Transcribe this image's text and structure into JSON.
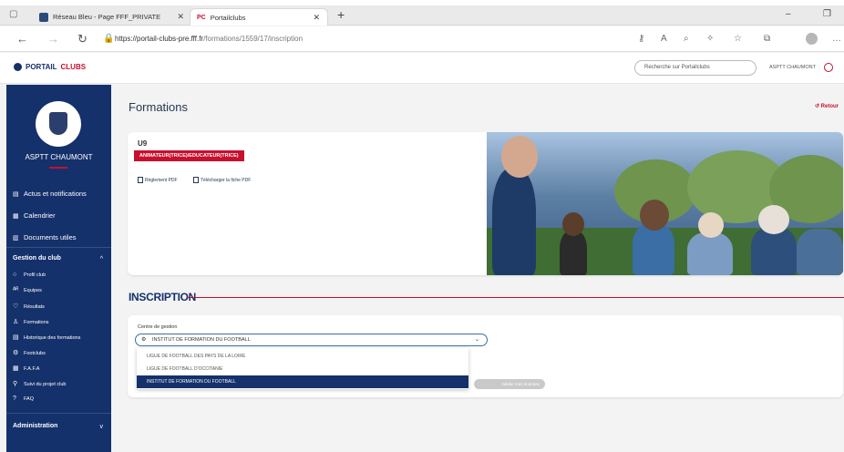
{
  "browser": {
    "tabs": [
      {
        "title": "Réseau Bleu - Page FFF_PRIVATE",
        "active": false
      },
      {
        "title": "Portailclubs",
        "favicon_text": "PC",
        "active": true
      }
    ],
    "url_base": "https://portail-clubs-pre.fff.fr",
    "url_path": "/formations/1559/17/inscription"
  },
  "header": {
    "logo_part1": "PORTAIL",
    "logo_part2": "CLUBS",
    "search_placeholder": "Recherche sur Portailclubs",
    "user": "ASPTT CHAUMONT"
  },
  "sidebar": {
    "club_name": "ASPTT CHAUMONT",
    "items": [
      {
        "label": "Actus et notifications",
        "icon": "news-icon"
      },
      {
        "label": "Calendrier",
        "icon": "calendar-icon"
      },
      {
        "label": "Documents utiles",
        "icon": "documents-icon"
      }
    ],
    "section_gestion": "Gestion du club",
    "sub_items": [
      {
        "label": "Profil club",
        "icon": "profile-icon"
      },
      {
        "label": "Equipes",
        "icon": "teams-icon"
      },
      {
        "label": "Résultats",
        "icon": "trophy-icon"
      },
      {
        "label": "Formations",
        "icon": "person-icon"
      },
      {
        "label": "Historique des formations",
        "icon": "history-icon"
      },
      {
        "label": "Footclubs",
        "icon": "football-icon"
      },
      {
        "label": "F.A.F.A",
        "icon": "grid-icon"
      },
      {
        "label": "Suivi du projet club",
        "icon": "project-icon"
      },
      {
        "label": "FAQ",
        "icon": "help-icon"
      }
    ],
    "section_admin": "Administration"
  },
  "main": {
    "title": "Formations",
    "back": "Retour",
    "card": {
      "title": "U9",
      "badge": "ANIMATEUR(TRICE)/EDUCATEUR(TRICE)",
      "link1": "Règlement PDF",
      "link2": "Télécharger la fiche PDF"
    },
    "inscription_title": "INSCRIPTION",
    "form": {
      "label": "Centre de gestion",
      "selected": "INSTITUT DE FORMATION DU FOOTBALL",
      "options": [
        "LIGUE DE FOOTBALL DES PAYS DE LA LOIRE",
        "LIGUE DE FOOTBALL D'OCCITANIE",
        "INSTITUT DE FORMATION DU FOOTBALL"
      ],
      "button_partial": "Valider mes données"
    }
  },
  "colors": {
    "navy": "#14316b",
    "red": "#c8102e"
  }
}
